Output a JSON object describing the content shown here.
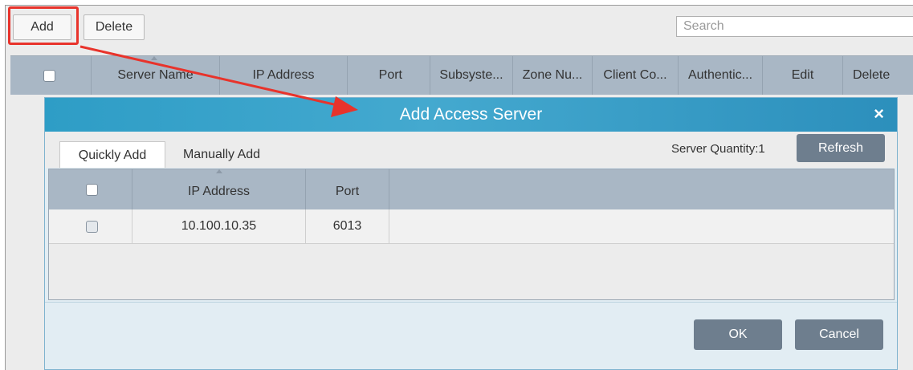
{
  "toolbar": {
    "add_label": "Add",
    "delete_label": "Delete",
    "search_placeholder": "Search"
  },
  "main_table": {
    "columns": [
      "Server Name",
      "IP Address",
      "Port",
      "Subsyste...",
      "Zone Nu...",
      "Client Co...",
      "Authentic...",
      "Edit",
      "Delete"
    ]
  },
  "dialog": {
    "title": "Add  Access Server",
    "close_glyph": "×",
    "tabs": [
      "Quickly Add",
      "Manually Add"
    ],
    "server_quantity": "Server Quantity:1",
    "refresh_label": "Refresh",
    "table": {
      "columns": [
        "IP Address",
        "Port"
      ],
      "rows": [
        {
          "ip": "10.100.10.35",
          "port": "6013"
        }
      ]
    },
    "ok_label": "OK",
    "cancel_label": "Cancel"
  },
  "colors": {
    "highlight": "#e8332b",
    "title_bar": "#2e9dc6",
    "header": "#a9b7c5",
    "dark_button": "#6e7e8e"
  }
}
